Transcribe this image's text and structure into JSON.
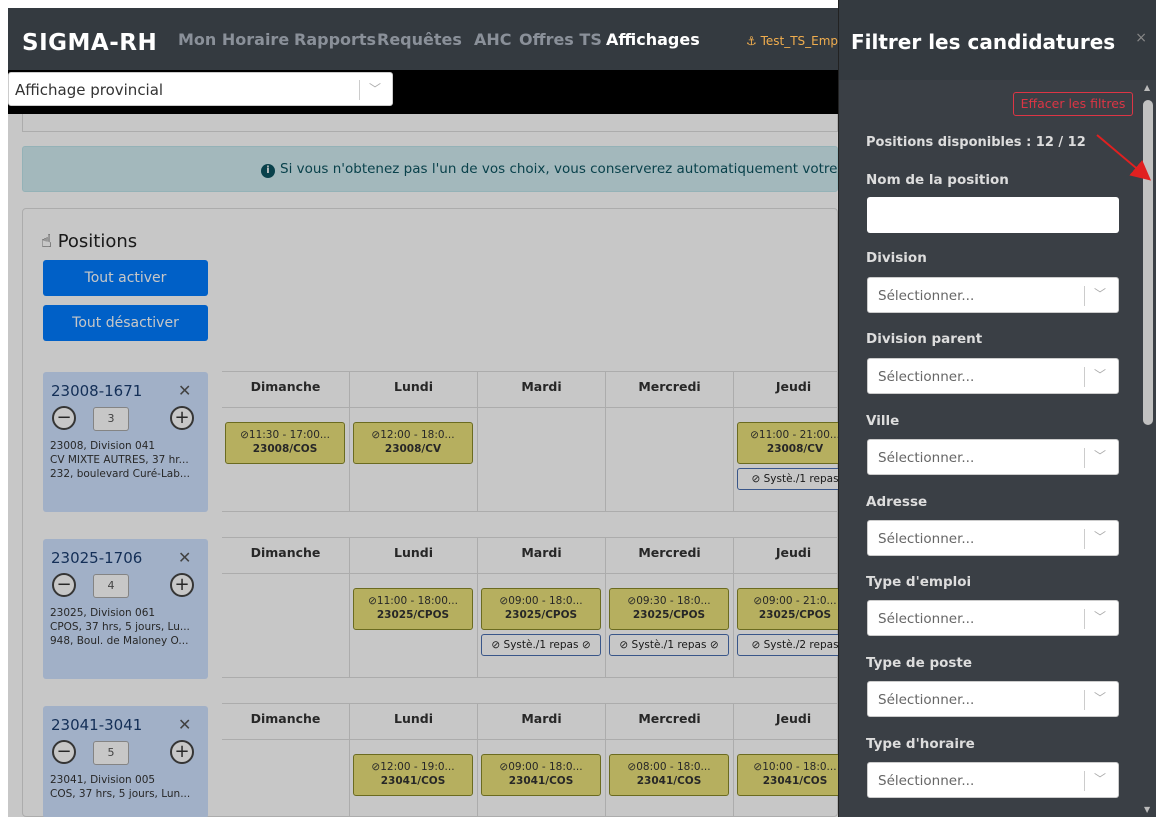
{
  "nav": {
    "logo": "SIGMA-RH",
    "items": [
      "Mon Horaire",
      "Rapports",
      "Requêtes",
      "AHC",
      "Offres TS",
      "Affichages"
    ],
    "user": "⚓ Test_TS_Emp"
  },
  "affichage_select": {
    "value": "Affichage provincial"
  },
  "alert": {
    "text": "Si vous n'obtenez pas l'un de vos choix, vous conserverez automatiquement votre p"
  },
  "positions": {
    "title": "Positions",
    "activate_all": "Tout activer",
    "deactivate_all": "Tout désactiver",
    "days": [
      "Dimanche",
      "Lundi",
      "Mardi",
      "Mercredi",
      "Jeudi"
    ],
    "items": [
      {
        "id": "23008-1671",
        "count": "3",
        "line1": "23008, Division 041",
        "line2": "CV MIXTE AUTRES, 37 hr...",
        "line3": "232, boulevard Curé-Lab...",
        "shifts": [
          {
            "day": 0,
            "time": "11:30 - 17:00...",
            "code": "23008/COS"
          },
          {
            "day": 1,
            "time": "12:00 - 18:0...",
            "code": "23008/CV"
          },
          {
            "day": 4,
            "time": "11:00 - 21:00...",
            "code": "23008/CV"
          }
        ],
        "syst": [
          {
            "day": 4,
            "text": "Systè./1 repas"
          }
        ]
      },
      {
        "id": "23025-1706",
        "count": "4",
        "line1": "23025, Division 061",
        "line2": "CPOS, 37 hrs, 5 jours, Lu...",
        "line3": "948, Boul. de Maloney O...",
        "shifts": [
          {
            "day": 1,
            "time": "11:00 - 18:00...",
            "code": "23025/CPOS"
          },
          {
            "day": 2,
            "time": "09:00 - 18:0...",
            "code": "23025/CPOS"
          },
          {
            "day": 3,
            "time": "09:30 - 18:0...",
            "code": "23025/CPOS"
          },
          {
            "day": 4,
            "time": "09:00 - 21:0...",
            "code": "23025/CPOS"
          }
        ],
        "syst": [
          {
            "day": 2,
            "text": "Systè./1 repas"
          },
          {
            "day": 3,
            "text": "Systè./1 repas"
          },
          {
            "day": 4,
            "text": "Systè./2 repas"
          }
        ]
      },
      {
        "id": "23041-3041",
        "count": "5",
        "line1": "23041, Division 005",
        "line2": "COS, 37 hrs, 5 jours, Lun...",
        "line3": "",
        "shifts": [
          {
            "day": 1,
            "time": "12:00 - 19:0...",
            "code": "23041/COS"
          },
          {
            "day": 2,
            "time": "09:00 - 18:0...",
            "code": "23041/COS"
          },
          {
            "day": 3,
            "time": "08:00 - 18:0...",
            "code": "23041/COS"
          },
          {
            "day": 4,
            "time": "10:00 - 18:0...",
            "code": "23041/COS"
          }
        ],
        "syst": []
      }
    ]
  },
  "filter_panel": {
    "title": "Filtrer les candidatures",
    "close": "×",
    "clear": "Effacer les filtres",
    "available": "Positions disponibles : 12 / 12",
    "name_label": "Nom de la position",
    "name_value": "",
    "placeholder": "Sélectionner...",
    "selects": [
      "Division",
      "Division parent",
      "Ville",
      "Adresse",
      "Type d'emploi",
      "Type de poste",
      "Type d'horaire"
    ]
  },
  "colors": {
    "shift_bg": "#e9e17a",
    "pos_bg": "#cfe2ff",
    "button": "#007bff",
    "panel": "#343a40",
    "arrow": "#e02020"
  }
}
